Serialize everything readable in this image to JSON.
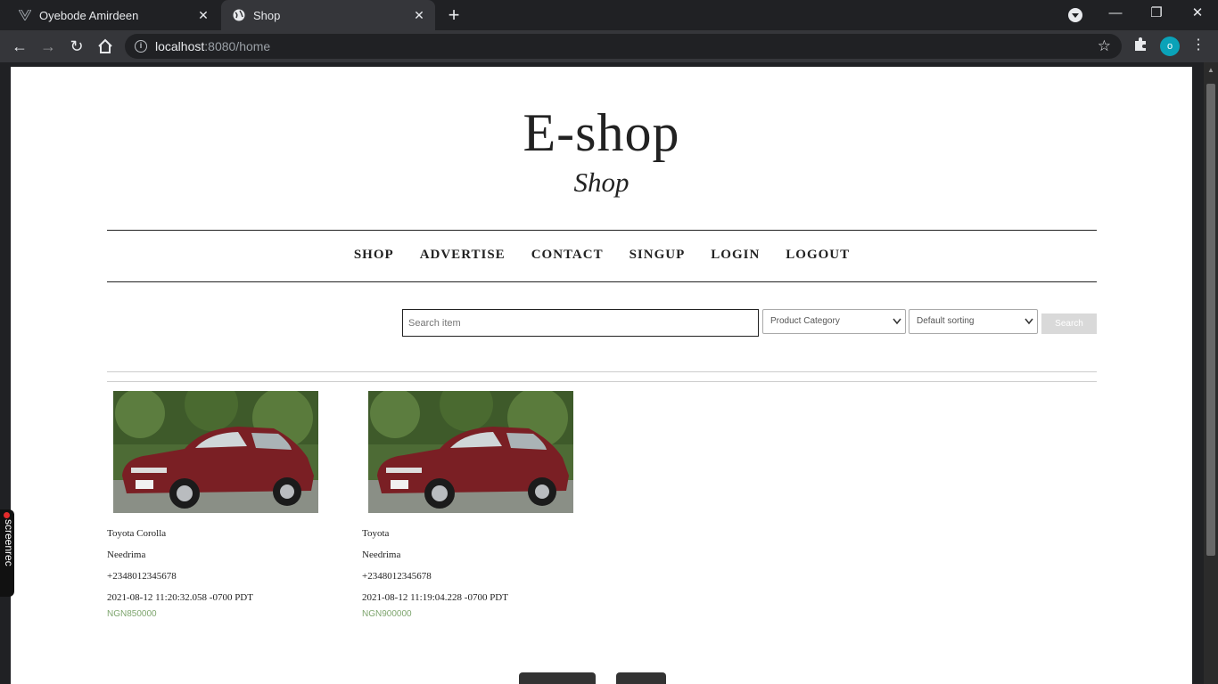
{
  "browser": {
    "tabs": [
      {
        "title": "Oyebode Amirdeen",
        "active": false
      },
      {
        "title": "Shop",
        "active": true
      }
    ],
    "url_host": "localhost",
    "url_path": ":8080/home",
    "profile_initial": "o",
    "window_controls": {
      "minimize": "—",
      "restore": "❐",
      "close": "✕"
    }
  },
  "site": {
    "title": "E-shop",
    "subtitle": "Shop",
    "nav": [
      "SHOP",
      "ADVERTISE",
      "CONTACT",
      "SINGUP",
      "LOGIN",
      "LOGOUT"
    ]
  },
  "search": {
    "placeholder": "Search item",
    "category_select": "Product Category",
    "sort_select": "Default sorting",
    "button": "Search"
  },
  "products": [
    {
      "name": "Toyota Corolla",
      "seller": "Needrima",
      "phone": "+2348012345678",
      "timestamp": "2021-08-12 11:20:32.058 -0700 PDT",
      "price": "NGN850000"
    },
    {
      "name": "Toyota",
      "seller": "Needrima",
      "phone": "+2348012345678",
      "timestamp": "2021-08-12 11:19:04.228 -0700 PDT",
      "price": "NGN900000"
    }
  ],
  "overlay": {
    "screenrec_label": "screenrec"
  },
  "colors": {
    "price": "#7fa66f",
    "profile": "#0aa2b8",
    "chrome_bg": "#202124",
    "toolbar_bg": "#35363a"
  }
}
